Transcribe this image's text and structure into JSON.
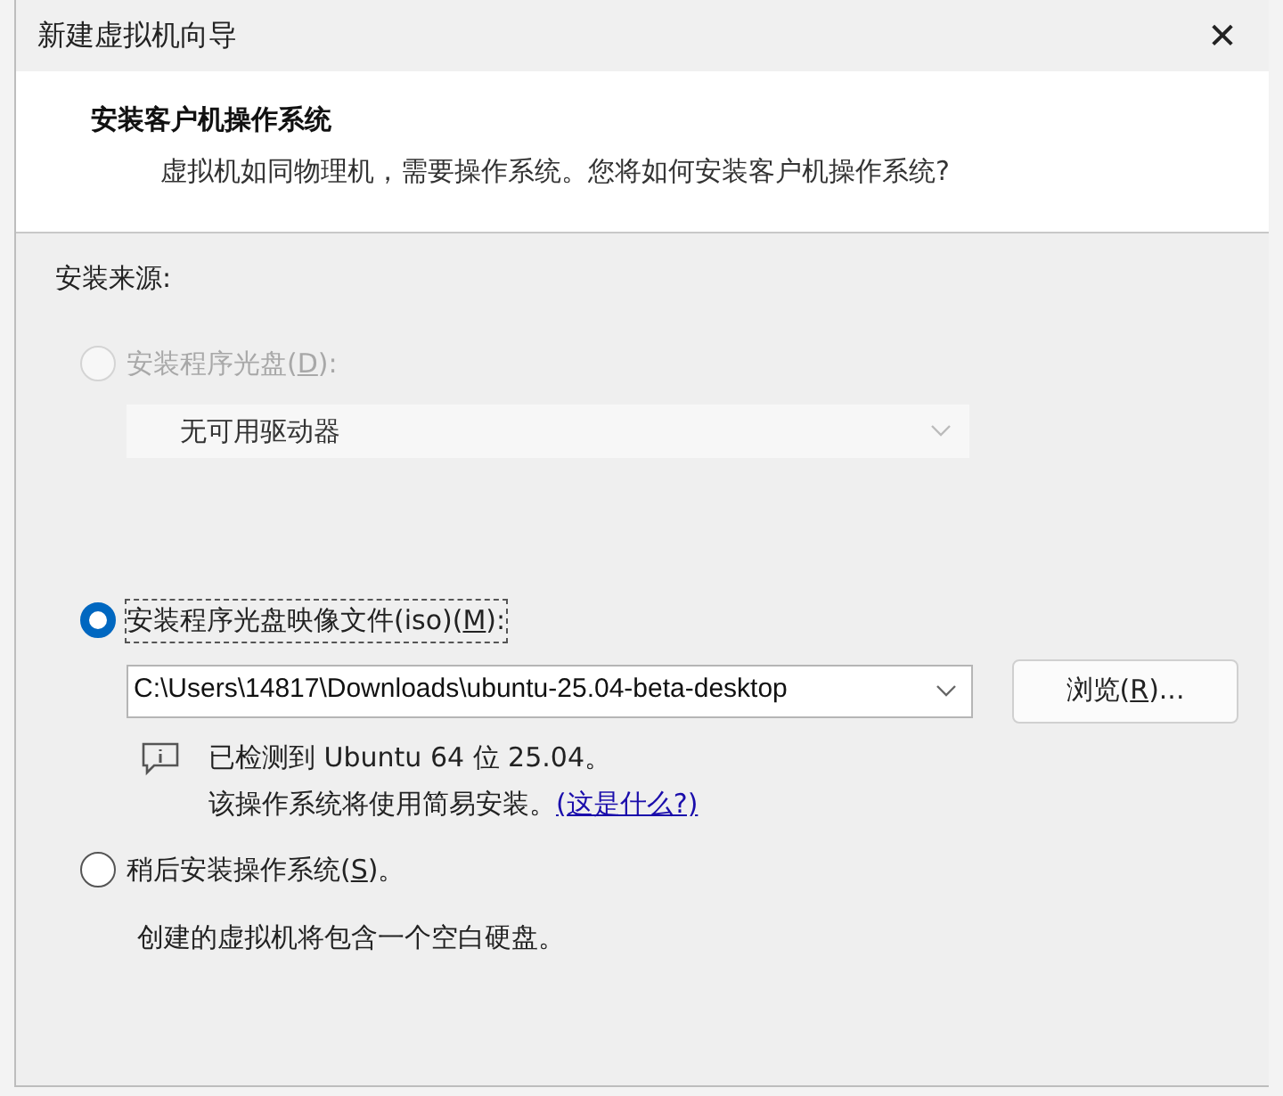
{
  "window": {
    "title": "新建虚拟机向导",
    "close": "✕"
  },
  "header": {
    "title": "安装客户机操作系统",
    "subtitle": "虚拟机如同物理机，需要操作系统。您将如何安装客户机操作系统?"
  },
  "source_label": "安装来源:",
  "options": [
    {
      "kind": "disc",
      "label": {
        "before": "安装程序光盘(",
        "key": "D",
        "after": "):"
      },
      "selected": false,
      "disabled": true,
      "dropdown": {
        "value": "无可用驱动器",
        "disabled": true
      }
    },
    {
      "kind": "iso",
      "label": {
        "before": "安装程序光盘映像文件(iso)(",
        "key": "M",
        "after": "):"
      },
      "selected": true,
      "disabled": false,
      "focused": true,
      "path": "C:\\Users\\14817\\Downloads\\ubuntu-25.04-beta-desktop",
      "browse": {
        "before": "浏览(",
        "key": "R",
        "after": ")..."
      },
      "info": {
        "line1": "已检测到 Ubuntu 64 位 25.04。",
        "line2": "该操作系统将使用简易安装。",
        "link": "(这是什么?)"
      }
    },
    {
      "kind": "later",
      "label": {
        "before": "稍后安装操作系统(",
        "key": "S",
        "after": ")。"
      },
      "selected": false,
      "disabled": false,
      "note": "创建的虚拟机将包含一个空白硬盘。"
    }
  ]
}
